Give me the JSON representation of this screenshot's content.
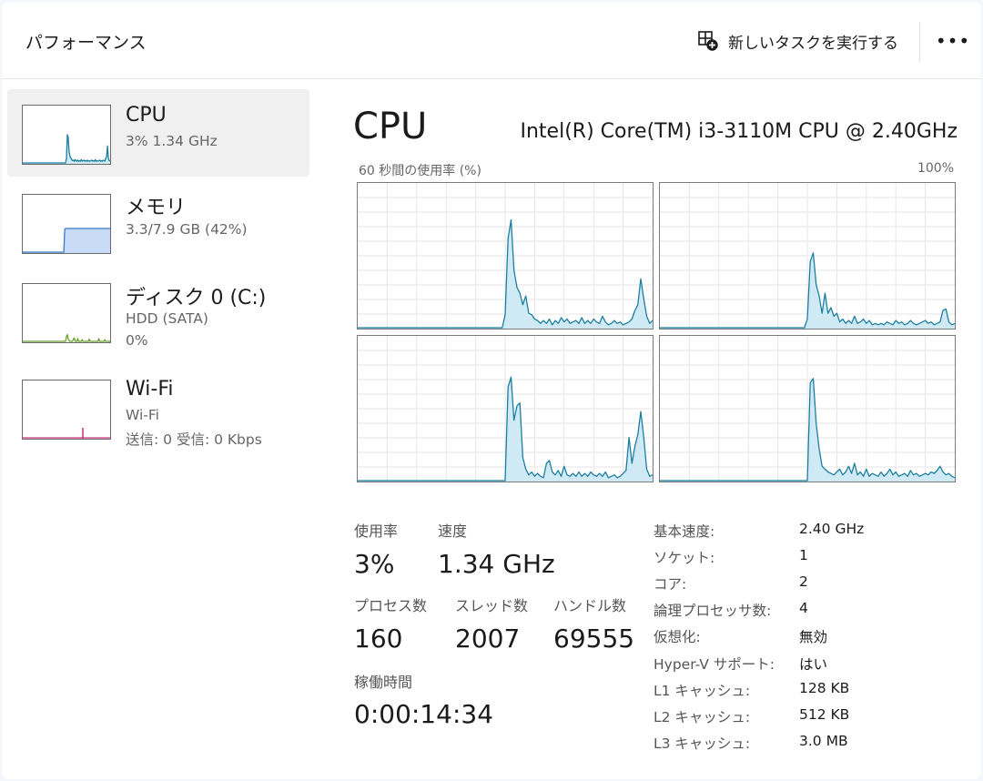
{
  "header": {
    "title": "パフォーマンス",
    "run_task_label": "新しいタスクを実行する",
    "more_label": "•••"
  },
  "sidebar": {
    "items": [
      {
        "title": "CPU",
        "sub1": "3%  1.34 GHz",
        "sub2": "",
        "selected": true
      },
      {
        "title": "メモリ",
        "sub1": "3.3/7.9 GB (42%)",
        "sub2": "",
        "selected": false
      },
      {
        "title": "ディスク 0 (C:)",
        "sub1": "HDD (SATA)",
        "sub2": "0%",
        "selected": false
      },
      {
        "title": "Wi-Fi",
        "sub1": "Wi-Fi",
        "sub2": "送信: 0 受信: 0 Kbps",
        "selected": false
      }
    ]
  },
  "main": {
    "title": "CPU",
    "model": "Intel(R) Core(TM) i3-3110M CPU @ 2.40GHz",
    "graph_label": "60 秒間の使用率 (%)",
    "graph_max": "100%"
  },
  "stats": {
    "usage_label": "使用率",
    "usage_value": "3%",
    "speed_label": "速度",
    "speed_value": "1.34 GHz",
    "processes_label": "プロセス数",
    "processes_value": "160",
    "threads_label": "スレッド数",
    "threads_value": "2007",
    "handles_label": "ハンドル数",
    "handles_value": "69555",
    "uptime_label": "稼働時間",
    "uptime_value": "0:00:14:34"
  },
  "specs": [
    {
      "label": "基本速度:",
      "value": "2.40 GHz"
    },
    {
      "label": "ソケット:",
      "value": "1"
    },
    {
      "label": "コア:",
      "value": "2"
    },
    {
      "label": "論理プロセッサ数:",
      "value": "4"
    },
    {
      "label": "仮想化:",
      "value": "無効"
    },
    {
      "label": "Hyper-V サポート:",
      "value": "はい"
    },
    {
      "label": "L1 キャッシュ:",
      "value": "128 KB"
    },
    {
      "label": "L2 キャッシュ:",
      "value": "512 KB"
    },
    {
      "label": "L3 キャッシュ:",
      "value": "3.0 MB"
    }
  ],
  "colors": {
    "cpu_line": "#1c7fa0",
    "cpu_fill": "#cfeaf4",
    "memory_line": "#3c78c8",
    "memory_fill": "#c7dbf6",
    "disk_line": "#6aa02a",
    "wifi_line": "#c8307a",
    "grid": "#e6e6e6"
  },
  "icons": {
    "run_task": "new-task-icon",
    "more": "more-icon"
  },
  "chart_data": {
    "type": "area",
    "graph_label": "60 秒間の使用率 (%)",
    "ylim": [
      0,
      100
    ],
    "grid": true,
    "series": [
      {
        "values": [
          0,
          0,
          0,
          0,
          0,
          0,
          0,
          0,
          0,
          0,
          0,
          0,
          0,
          0,
          0,
          0,
          0,
          0,
          0,
          0,
          0,
          0,
          0,
          0,
          0,
          0,
          0,
          0,
          0,
          0,
          0,
          0,
          0,
          0,
          0,
          0,
          0,
          0,
          0,
          0,
          0,
          0,
          0,
          0,
          0,
          0,
          0,
          0,
          0,
          0,
          9,
          62,
          75,
          40,
          28,
          24,
          16,
          22,
          10,
          9,
          6,
          5,
          3,
          5,
          3,
          6,
          2,
          5,
          3,
          7,
          4,
          6,
          3,
          4,
          5,
          3,
          7,
          3,
          5,
          3,
          6,
          4,
          3,
          8,
          4,
          2,
          3,
          5,
          3,
          4,
          2,
          3,
          4,
          6,
          12,
          16,
          34,
          20,
          8,
          3,
          5
        ]
      },
      {
        "values": [
          0,
          0,
          0,
          0,
          0,
          0,
          0,
          0,
          0,
          0,
          0,
          0,
          0,
          0,
          0,
          0,
          0,
          0,
          0,
          0,
          0,
          0,
          0,
          0,
          0,
          0,
          0,
          0,
          0,
          0,
          0,
          0,
          0,
          0,
          0,
          0,
          0,
          0,
          0,
          0,
          0,
          0,
          0,
          0,
          0,
          0,
          0,
          0,
          0,
          0,
          6,
          46,
          52,
          30,
          22,
          10,
          24,
          10,
          14,
          8,
          10,
          4,
          6,
          3,
          5,
          3,
          8,
          3,
          4,
          6,
          3,
          5,
          2,
          3,
          2,
          3,
          2,
          4,
          3,
          2,
          5,
          3,
          4,
          2,
          3,
          5,
          3,
          2,
          3,
          4,
          5,
          3,
          4,
          2,
          3,
          4,
          12,
          13,
          4,
          2,
          3
        ]
      },
      {
        "values": [
          0,
          0,
          0,
          0,
          0,
          0,
          0,
          0,
          0,
          0,
          0,
          0,
          0,
          0,
          0,
          0,
          0,
          0,
          0,
          0,
          0,
          0,
          0,
          0,
          0,
          0,
          0,
          0,
          0,
          0,
          0,
          0,
          0,
          0,
          0,
          0,
          0,
          0,
          0,
          0,
          0,
          0,
          0,
          0,
          0,
          0,
          0,
          0,
          0,
          0,
          0,
          65,
          72,
          42,
          52,
          54,
          16,
          8,
          4,
          6,
          3,
          5,
          3,
          2,
          12,
          14,
          6,
          4,
          7,
          3,
          10,
          4,
          3,
          5,
          3,
          6,
          3,
          5,
          3,
          6,
          4,
          3,
          5,
          3,
          6,
          2,
          3,
          4,
          2,
          3,
          5,
          7,
          30,
          12,
          24,
          32,
          48,
          30,
          8,
          3,
          4
        ]
      },
      {
        "values": [
          0,
          0,
          0,
          0,
          0,
          0,
          0,
          0,
          0,
          0,
          0,
          0,
          0,
          0,
          0,
          0,
          0,
          0,
          0,
          0,
          0,
          0,
          0,
          0,
          0,
          0,
          0,
          0,
          0,
          0,
          0,
          0,
          0,
          0,
          0,
          0,
          0,
          0,
          0,
          0,
          0,
          0,
          0,
          0,
          0,
          0,
          0,
          0,
          0,
          0,
          0,
          68,
          71,
          40,
          22,
          10,
          8,
          6,
          5,
          4,
          6,
          8,
          4,
          6,
          10,
          5,
          12,
          4,
          6,
          3,
          8,
          3,
          5,
          4,
          3,
          6,
          3,
          5,
          8,
          4,
          6,
          3,
          4,
          5,
          3,
          7,
          4,
          5,
          3,
          4,
          5,
          4,
          6,
          5,
          7,
          10,
          6,
          4,
          5,
          3,
          2
        ]
      }
    ]
  },
  "sidebar_sparks": {
    "cpu": [
      0,
      0,
      0,
      0,
      0,
      0,
      0,
      0,
      0,
      0,
      0,
      0,
      0,
      0,
      0,
      0,
      0,
      0,
      0,
      0,
      0,
      0,
      0,
      0,
      0,
      0,
      0,
      0,
      0,
      0,
      0,
      0,
      0,
      0,
      0,
      0,
      0,
      0,
      0,
      0,
      0,
      0,
      0,
      0,
      0,
      0,
      0,
      0,
      0,
      0,
      8,
      50,
      45,
      20,
      12,
      9,
      6,
      4,
      5,
      3,
      6,
      4,
      3,
      5,
      3,
      4,
      3,
      6,
      3,
      4,
      5,
      3,
      4,
      3,
      5,
      3,
      4,
      3,
      4,
      5,
      3,
      4,
      3,
      6,
      3,
      4,
      3,
      4,
      5,
      3,
      4,
      3,
      5,
      4,
      3,
      8,
      12,
      30,
      8,
      4,
      3
    ],
    "memory": [
      0,
      0,
      0,
      0,
      0,
      0,
      0,
      0,
      0,
      0,
      0,
      0,
      0,
      0,
      0,
      0,
      0,
      0,
      0,
      0,
      0,
      0,
      0,
      0,
      0,
      0,
      0,
      0,
      0,
      0,
      0,
      0,
      0,
      0,
      0,
      0,
      0,
      0,
      0,
      0,
      0,
      0,
      0,
      0,
      0,
      0,
      0,
      0,
      40,
      42,
      42,
      42,
      42,
      42,
      42,
      42,
      42,
      42,
      42,
      42,
      42,
      42,
      42,
      42,
      42,
      42,
      42,
      42,
      42,
      42,
      42,
      42,
      42,
      42,
      42,
      42,
      42,
      42,
      42,
      42,
      42,
      42,
      42,
      42,
      42,
      42,
      42,
      42,
      42,
      42,
      42,
      42,
      42,
      42,
      42,
      42,
      42,
      42,
      42,
      42,
      42
    ],
    "disk": [
      0,
      0,
      0,
      0,
      0,
      0,
      0,
      0,
      0,
      0,
      0,
      0,
      0,
      0,
      0,
      0,
      0,
      0,
      0,
      0,
      0,
      0,
      0,
      0,
      0,
      0,
      0,
      0,
      0,
      0,
      0,
      0,
      0,
      0,
      0,
      0,
      0,
      0,
      0,
      0,
      0,
      0,
      0,
      0,
      0,
      0,
      0,
      0,
      0,
      0,
      8,
      12,
      4,
      2,
      0,
      0,
      0,
      0,
      4,
      6,
      0,
      0,
      0,
      5,
      0,
      0,
      0,
      0,
      3,
      0,
      0,
      0,
      0,
      0,
      0,
      0,
      4,
      0,
      0,
      0,
      0,
      0,
      0,
      0,
      0,
      0,
      0,
      5,
      0,
      0,
      0,
      0,
      0,
      0,
      3,
      0,
      0,
      0,
      0,
      0,
      0
    ],
    "wifi": [
      0,
      0,
      0,
      0,
      0,
      0,
      0,
      0,
      0,
      0,
      0,
      0,
      0,
      0,
      0,
      0,
      0,
      0,
      0,
      0,
      0,
      0,
      0,
      0,
      0,
      0,
      0,
      0,
      0,
      0,
      0,
      0,
      0,
      0,
      0,
      0,
      0,
      0,
      0,
      0,
      0,
      0,
      0,
      0,
      0,
      0,
      0,
      0,
      0,
      0,
      0,
      0,
      0,
      0,
      0,
      0,
      0,
      0,
      0,
      0,
      0,
      0,
      0,
      0,
      0,
      0,
      0,
      0,
      0,
      0,
      0,
      0,
      0,
      0,
      0,
      0,
      0,
      0,
      0,
      0,
      0,
      0,
      0,
      0,
      0,
      0,
      0,
      0,
      0,
      0,
      0,
      0,
      0,
      0,
      0,
      0,
      0,
      0,
      0,
      0,
      0
    ]
  }
}
